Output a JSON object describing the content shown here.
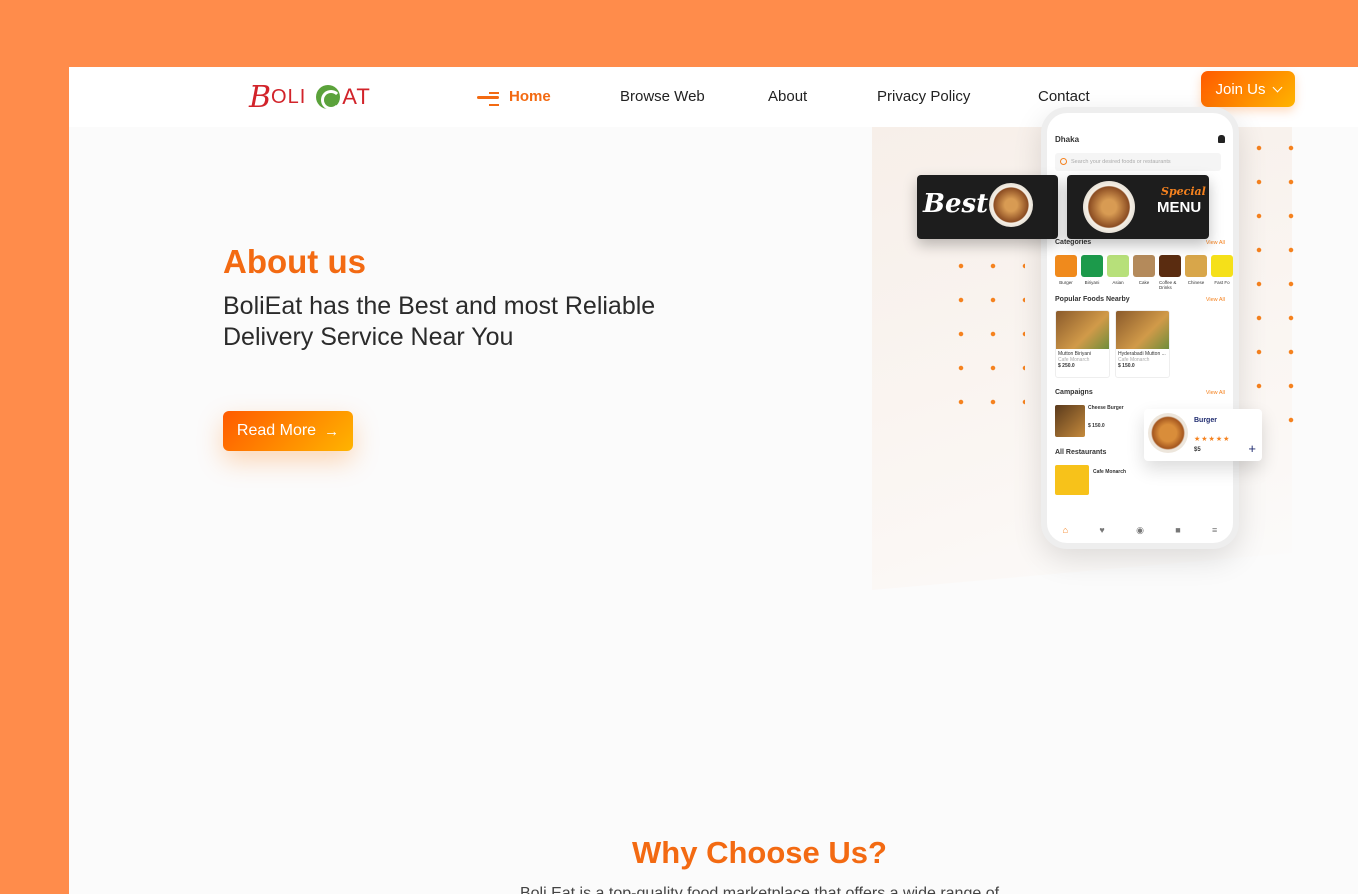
{
  "brand": {
    "logo_part1": "B",
    "logo_part2": "OLI",
    "logo_part3": "AT"
  },
  "nav": {
    "items": [
      {
        "label": "Home",
        "active": true
      },
      {
        "label": "Browse Web",
        "active": false
      },
      {
        "label": "About",
        "active": false
      },
      {
        "label": "Privacy Policy",
        "active": false
      },
      {
        "label": "Contact",
        "active": false
      }
    ],
    "join_label": "Join Us"
  },
  "hero": {
    "title": "About us",
    "subtitle": "BoliEat has the Best and most Reliable Delivery Service Near You",
    "read_more_label": "Read More",
    "read_more_arrow": "→"
  },
  "phone": {
    "location": "Dhaka",
    "search_placeholder": "Search your desired foods or restaurants",
    "banner1_text": "Best",
    "banner2_text": "MENU",
    "banner2_sub": "Special",
    "categories_title": "Categories",
    "view_all": "View All",
    "categories": [
      "Burger",
      "Biriyani",
      "Asian",
      "Cake",
      "Coffee & Drinks",
      "Chinese",
      "Fast Fo"
    ],
    "popular_title": "Popular Foods Nearby",
    "foods": [
      {
        "name": "Mutton Biriyani",
        "place": "Cafe Monarch",
        "price": "$ 250.0",
        "rating": "0.0"
      },
      {
        "name": "Hyderabadi Mutton ...",
        "place": "Cafe Monarch",
        "price": "$ 150.0",
        "rating": "0.0"
      }
    ],
    "campaigns_title": "Campaigns",
    "campaign": {
      "name": "Cheese Burger",
      "price": "$ 150.0"
    },
    "restaurants_title": "All Restaurants",
    "restaurant": {
      "name": "Cafe Monarch"
    },
    "float_card": {
      "name": "Burger",
      "stars": "★★★★★",
      "price": "$5",
      "plus": "+"
    }
  },
  "why": {
    "title": "Why Choose Us?",
    "text": "Boli Eat is a top-quality food marketplace that offers a wide range of"
  },
  "colors": {
    "accent": "#f36a12",
    "outer_bg": "#ff8c4b",
    "page_bg": "#fbfbfb"
  }
}
